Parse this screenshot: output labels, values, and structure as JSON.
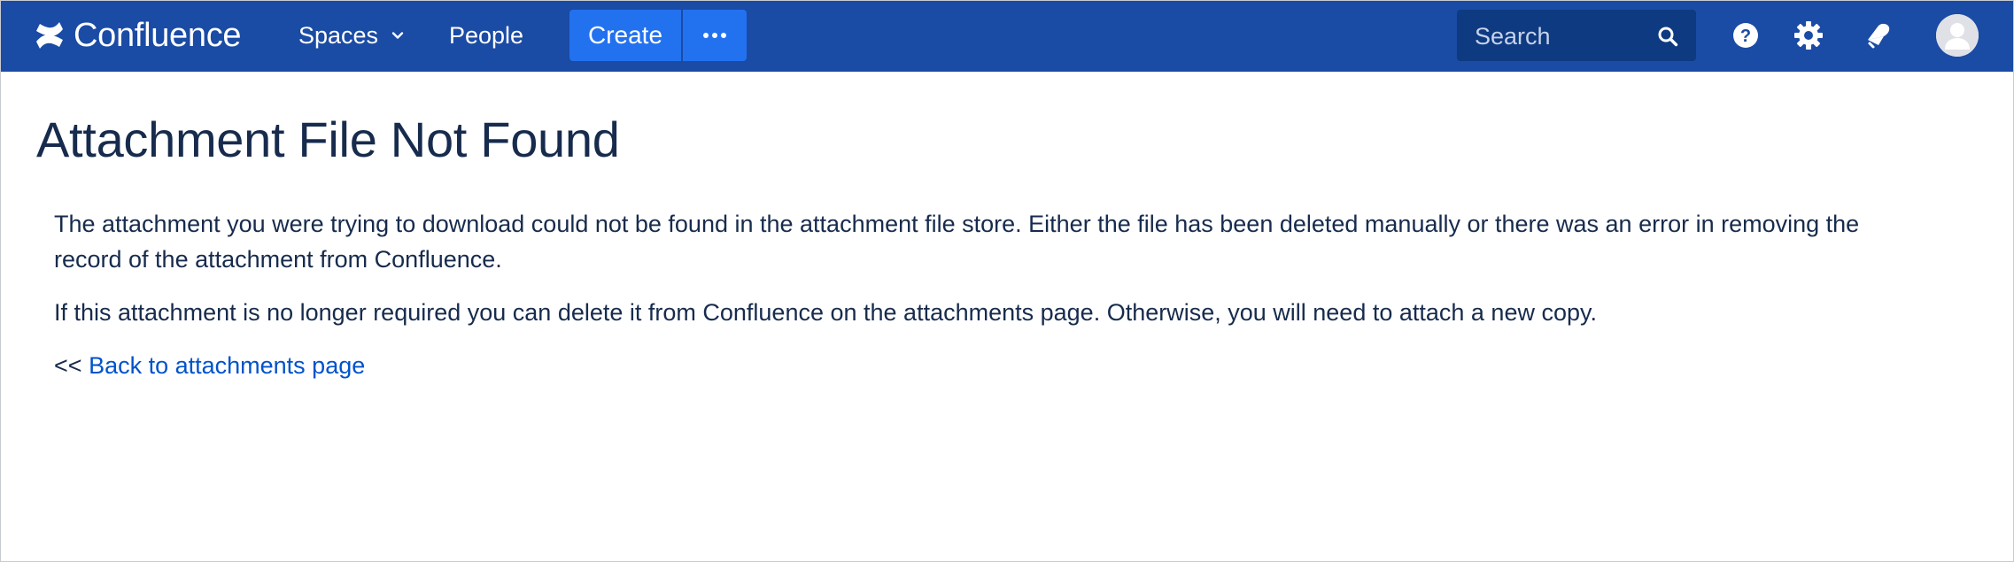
{
  "header": {
    "app_name": "Confluence",
    "nav": {
      "spaces_label": "Spaces",
      "people_label": "People"
    },
    "create_label": "Create",
    "search": {
      "placeholder": "Search"
    },
    "icons": [
      "confluence-logo-icon",
      "chevron-down-icon",
      "more-icon",
      "search-icon",
      "help-icon",
      "gear-icon",
      "notifications-icon",
      "avatar"
    ],
    "colors": {
      "header_bg": "#1a4ba5",
      "create_bg": "#2272f0",
      "search_bg": "#0e3a82"
    }
  },
  "main": {
    "title": "Attachment File Not Found",
    "paragraph_1": "The attachment you were trying to download could not be found in the attachment file store. Either the file has been deleted manually or there was an error in removing the record of the attachment from Confluence.",
    "paragraph_2": "If this attachment is no longer required you can delete it from Confluence on the attachments page. Otherwise, you will need to attach a new copy.",
    "back_prefix": "<<",
    "back_link_label": "Back to attachments page",
    "colors": {
      "text": "#172b4d",
      "link": "#0052cc"
    }
  }
}
